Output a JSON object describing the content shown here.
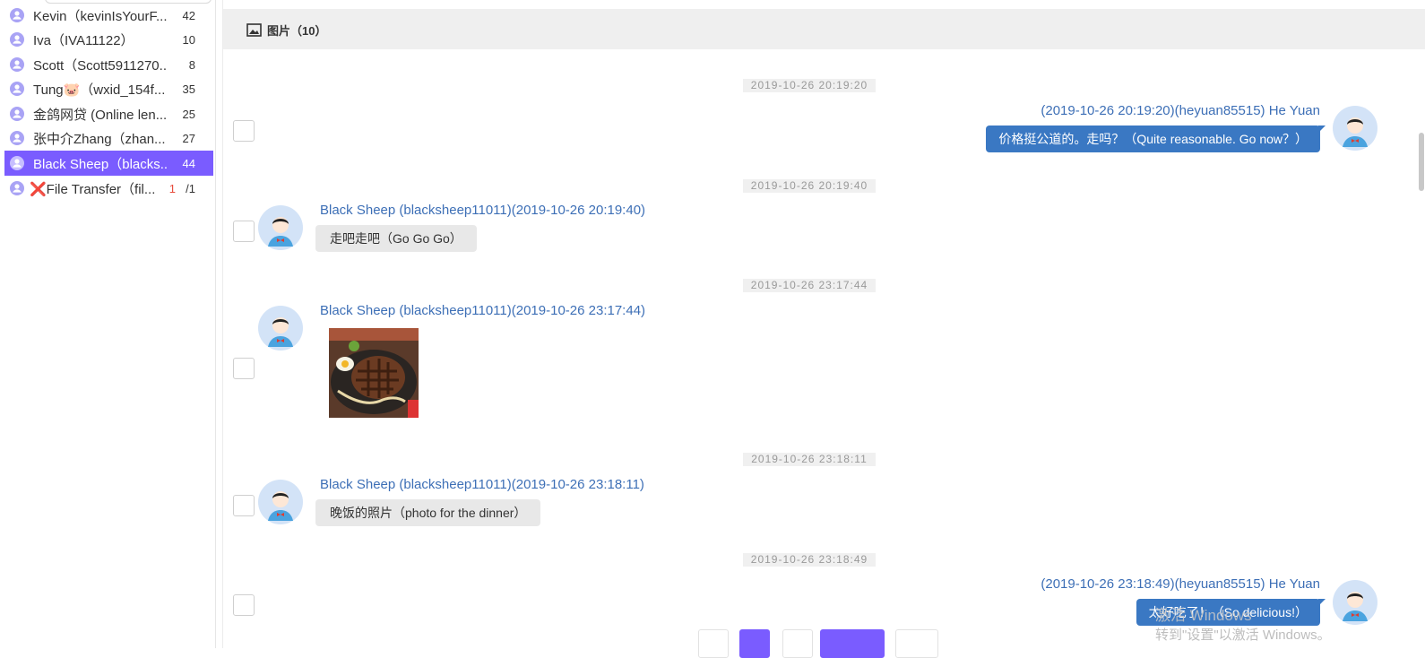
{
  "sidebar": {
    "contacts": [
      {
        "name": "Kevin（kevinIsYourF...",
        "count": "42"
      },
      {
        "name": "Iva（IVA11122）",
        "count": "10"
      },
      {
        "name": "Scott（Scott5911270...",
        "count": "8"
      },
      {
        "name": "Tung🐷（wxid_154f...",
        "count": "35"
      },
      {
        "name": "金鸽网贷 (Online len...",
        "count": "25"
      },
      {
        "name": "张中介Zhang（zhan...",
        "count": "27"
      },
      {
        "name": "Black Sheep（blacks...",
        "count": "44"
      },
      {
        "name": "❌File Transfer（fil...",
        "unread": "1",
        "total": "/1"
      }
    ],
    "active_index": 6
  },
  "tabs": {
    "images_label": "图片（10）"
  },
  "messages": [
    {
      "timestamp": "2019-10-26 20:19:20",
      "direction": "out",
      "sender": "(2019-10-26 20:19:20)(heyuan85515) He Yuan",
      "text": "价格挺公道的。走吗？（Quite reasonable. Go now？）"
    },
    {
      "timestamp": "2019-10-26 20:19:40",
      "direction": "in",
      "sender": "Black Sheep (blacksheep11011)(2019-10-26 20:19:40)",
      "text": "走吧走吧（Go Go Go）"
    },
    {
      "timestamp": "2019-10-26 23:17:44",
      "direction": "in",
      "sender": "Black Sheep (blacksheep11011)(2019-10-26 23:17:44)",
      "text": ""
    },
    {
      "timestamp": "2019-10-26 23:18:11",
      "direction": "in",
      "sender": "Black Sheep (blacksheep11011)(2019-10-26 23:18:11)",
      "text": "晚饭的照片（photo for the dinner）"
    },
    {
      "timestamp": "2019-10-26 23:18:49",
      "direction": "out",
      "sender": "(2019-10-26 23:18:49)(heyuan85515) He Yuan",
      "text": "太好吃了！（So delicious!）"
    }
  ],
  "watermark": {
    "line1": "激活 Windows",
    "line2": "转到\"设置\"以激活 Windows。"
  },
  "colors": {
    "accent": "#7a5cff",
    "sender_link": "#3d6fb6",
    "outgoing_bubble": "#3a78c3",
    "incoming_bubble": "#e8e8e8"
  }
}
